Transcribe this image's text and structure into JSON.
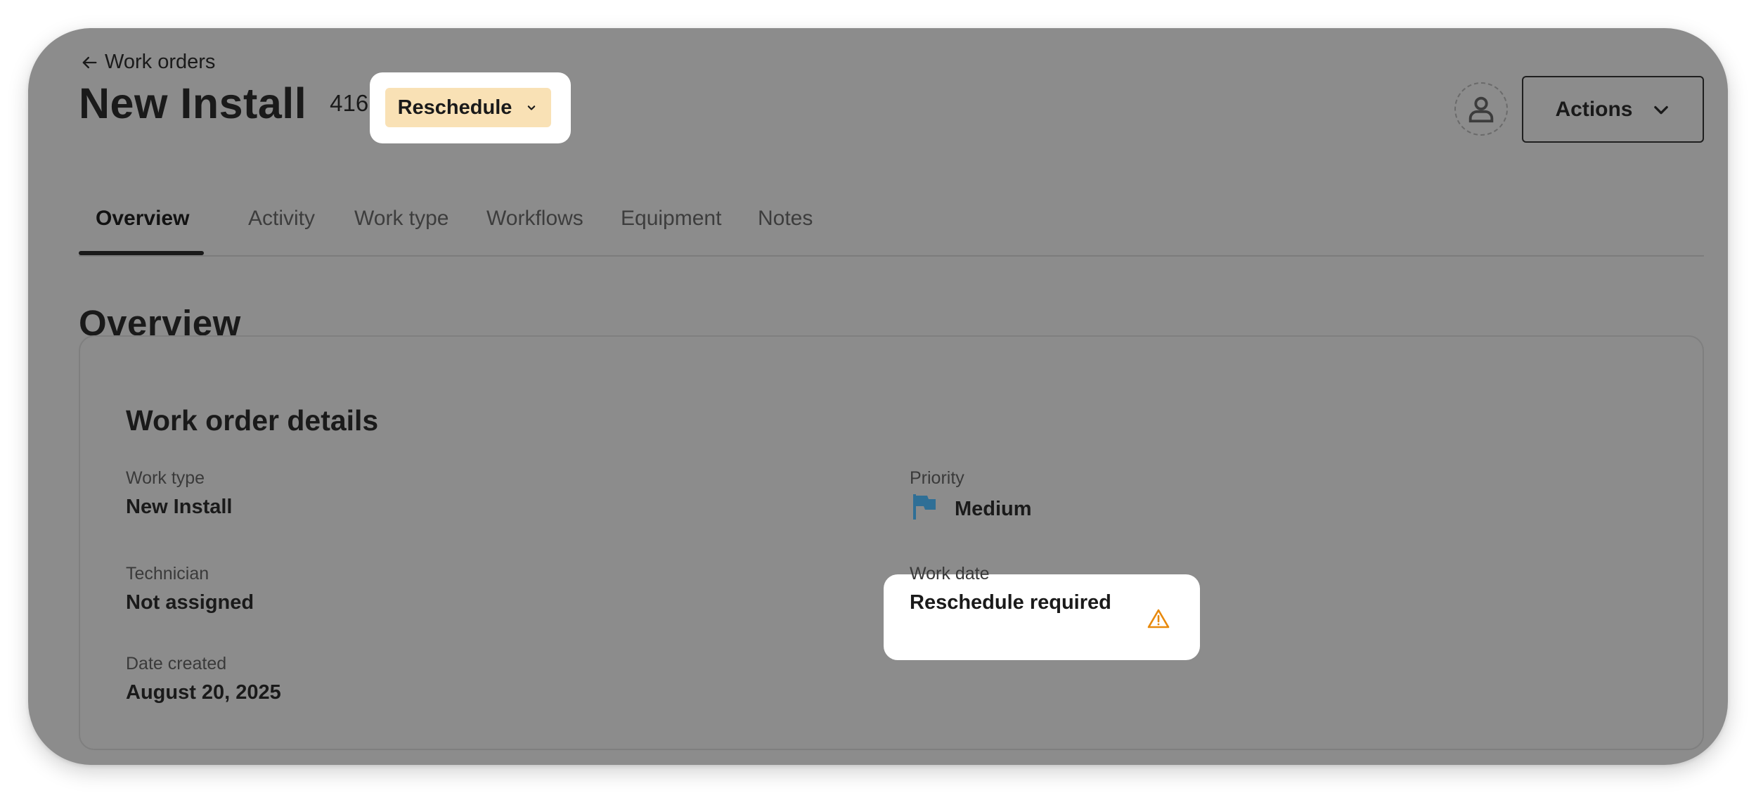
{
  "breadcrumb": {
    "back_label": "Work orders"
  },
  "header": {
    "title": "New Install",
    "number": "416",
    "status": "Reschedule",
    "actions_label": "Actions"
  },
  "tabs": [
    {
      "label": "Overview",
      "active": true
    },
    {
      "label": "Activity",
      "active": false
    },
    {
      "label": "Work type",
      "active": false
    },
    {
      "label": "Workflows",
      "active": false
    },
    {
      "label": "Equipment",
      "active": false
    },
    {
      "label": "Notes",
      "active": false
    }
  ],
  "overview": {
    "heading": "Overview",
    "card_title": "Work order details",
    "fields": {
      "work_type": {
        "label": "Work type",
        "value": "New Install"
      },
      "technician": {
        "label": "Technician",
        "value": "Not assigned"
      },
      "date_created": {
        "label": "Date created",
        "value": "August 20, 2025"
      },
      "priority": {
        "label": "Priority",
        "value": "Medium",
        "icon": "flag-icon"
      },
      "work_date": {
        "label": "Work date",
        "value": "Reschedule required",
        "icon": "warning-icon"
      }
    }
  },
  "colors": {
    "status_pill_bg": "#f9e1b5",
    "priority_flag": "#2f6f96",
    "warning": "#e8890c",
    "overlay": "#8c8c8c"
  }
}
